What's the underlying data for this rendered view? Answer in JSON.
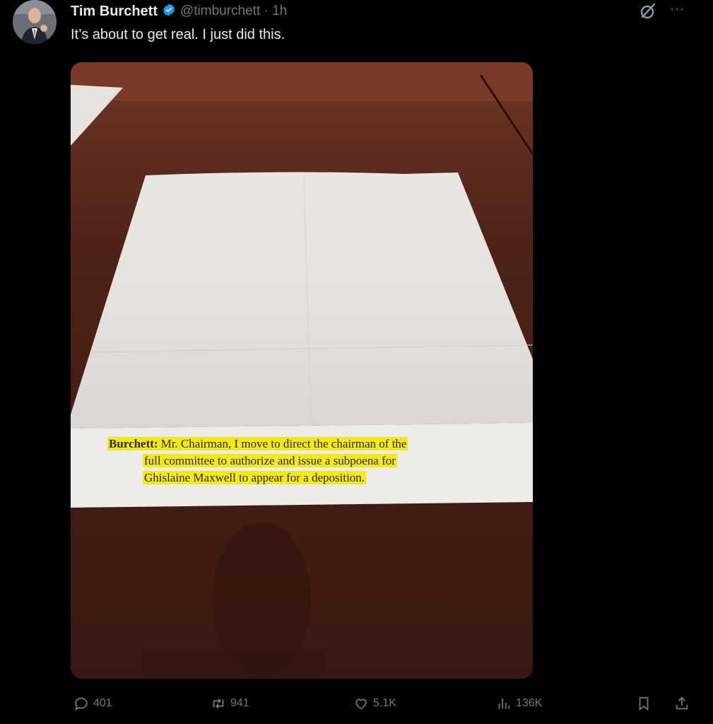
{
  "tweet": {
    "author_name": "Tim Burchett",
    "handle_time": "@timburchett · 1h",
    "text": "It’s about to get real. I just did this.",
    "more_label": "···"
  },
  "document": {
    "speaker": "Burchett:",
    "line1_rest": "Mr. Chairman, I move to direct the chairman of the",
    "line2": "full committee to authorize and issue a subpoena for",
    "line3": "Ghislaine Maxwell to appear for a deposition."
  },
  "actions": {
    "replies": "401",
    "reposts": "941",
    "likes": "5.1K",
    "views": "136K"
  },
  "colors": {
    "background": "#000000",
    "text": "#e7e9ea",
    "secondary": "#71767b",
    "verified": "#1d9bf0",
    "highlight": "#f2e81a"
  },
  "icons": [
    "verified-badge-icon",
    "grok-icon",
    "more-icon",
    "reply-icon",
    "repost-icon",
    "like-icon",
    "views-icon",
    "bookmark-icon",
    "share-icon"
  ]
}
